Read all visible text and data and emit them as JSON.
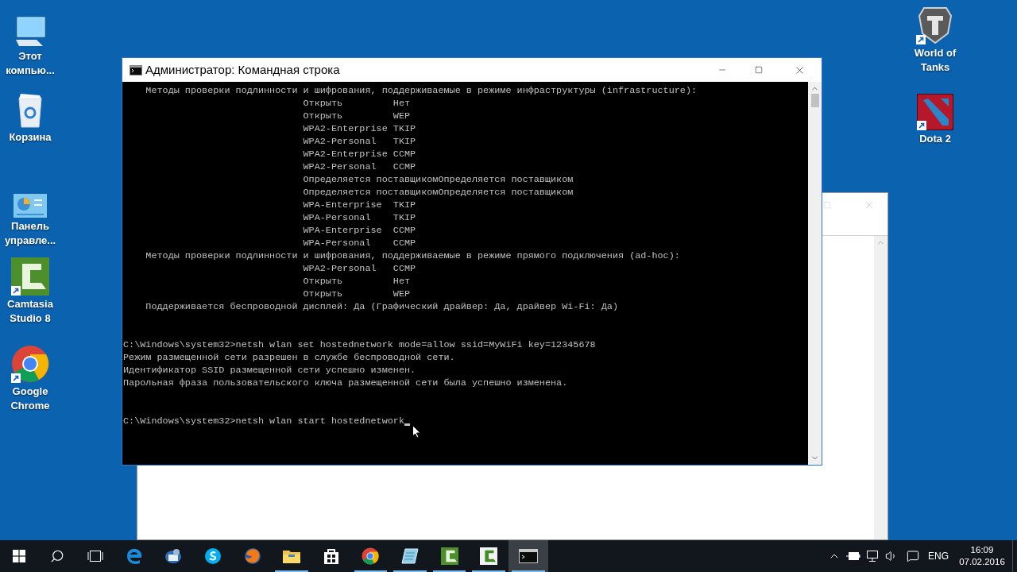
{
  "desktop": {
    "left_icons": [
      {
        "label": "Этот компью..."
      },
      {
        "label": "Корзина"
      },
      {
        "label": "Панель управле..."
      },
      {
        "label": "Camtasia Studio 8"
      },
      {
        "label": "Google Chrome"
      }
    ],
    "right_icons": [
      {
        "label": "World of Tanks"
      },
      {
        "label": "Dota 2"
      }
    ]
  },
  "window": {
    "title": "Администратор: Командная строка",
    "console": {
      "blocks": [
        {
          "lines": [
            "    Методы проверки подлинности и шифрования, поддерживаемые в режиме инфраструктуры (infrastructure):",
            "                                Открыть         Нет",
            "                                Открыть         WEP",
            "                                WPA2-Enterprise TKIP",
            "                                WPA2-Personal   TKIP",
            "                                WPA2-Enterprise CCMP",
            "                                WPA2-Personal   CCMP",
            "                                Определяется поставщикомОпределяется поставщиком",
            "                                Определяется поставщикомОпределяется поставщиком",
            "                                WPA-Enterprise  TKIP",
            "                                WPA-Personal    TKIP",
            "                                WPA-Enterprise  CCMP",
            "                                WPA-Personal    CCMP",
            "    Методы проверки подлинности и шифрования, поддерживаемые в режиме прямого подключения (ad-hoc):",
            "                                WPA2-Personal   CCMP",
            "                                Открыть         Нет",
            "                                Открыть         WEP",
            "    Поддерживается беспроводной дисплей: Да (Графический драйвер: Да, драйвер Wi-Fi: Да)"
          ]
        },
        {
          "lines": [
            "C:\\Windows\\system32>netsh wlan set hostednetwork mode=allow ssid=MyWiFi key=12345678",
            "Режим размещенной сети разрешен в службе беспроводной сети.",
            "Идентификатор SSID размещенной сети успешно изменен.",
            "Парольная фраза пользовательского ключа размещенной сети была успешно изменена."
          ]
        },
        {
          "lines": [
            "C:\\Windows\\system32>netsh wlan start hostednetwork"
          ]
        }
      ]
    }
  },
  "taskbar": {
    "apps": [
      {
        "running": false,
        "selected": false
      },
      {
        "running": false,
        "selected": false
      },
      {
        "running": false,
        "selected": false
      },
      {
        "running": false,
        "selected": false
      },
      {
        "running": true,
        "selected": false
      },
      {
        "running": false,
        "selected": false
      },
      {
        "running": true,
        "selected": false
      },
      {
        "running": true,
        "selected": false
      },
      {
        "running": true,
        "selected": false
      },
      {
        "running": true,
        "selected": false
      },
      {
        "running": true,
        "selected": true
      }
    ],
    "language": "ENG",
    "time": "16:09",
    "date": "07.02.2016"
  }
}
